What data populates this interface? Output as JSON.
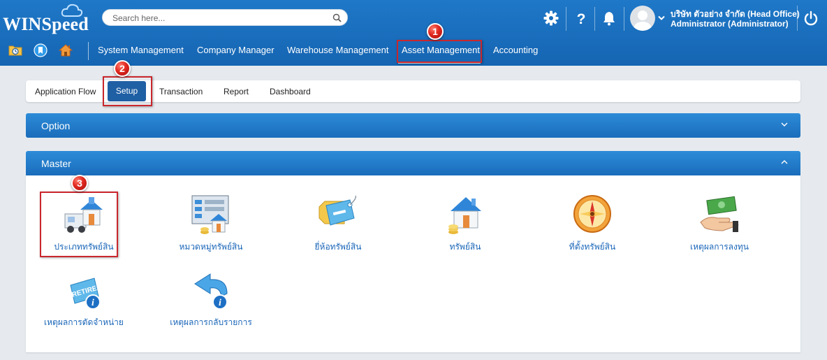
{
  "app": {
    "logo_text": "WINSpeed"
  },
  "search": {
    "placeholder": "Search here..."
  },
  "header": {
    "company": "บริษัท ตัวอย่าง จำกัด (Head Office)",
    "user": "Administrator (Administrator)"
  },
  "nav": {
    "items": [
      "System Management",
      "Company Manager",
      "Warehouse Management",
      "Asset Management",
      "Accounting"
    ],
    "active": "Asset Management"
  },
  "tabs": {
    "items": [
      "Application Flow",
      "Setup",
      "Transaction",
      "Report",
      "Dashboard"
    ],
    "active": "Setup"
  },
  "panels": {
    "option_title": "Option",
    "master_title": "Master"
  },
  "master_items": [
    "ประเภททรัพย์สิน",
    "หมวดหมู่ทรัพย์สิน",
    "ยี่ห้อทรัพย์สิน",
    "ทรัพย์สิน",
    "ที่ตั้งทรัพย์สิน",
    "เหตุผลการลงทุน",
    "เหตุผลการตัดจำหน่าย",
    "เหตุผลการกลับรายการ"
  ],
  "badges": [
    "1",
    "2",
    "3"
  ],
  "icons": {
    "header": [
      "gear-icon",
      "help-icon",
      "bell-icon",
      "power-icon"
    ],
    "quick": [
      "calendar-folder-icon",
      "bookmark-icon",
      "home-icon"
    ]
  },
  "colors": {
    "header_blue": "#1a6dbb",
    "highlight_red": "#c9272d",
    "link_blue": "#1a66b8",
    "active_tab": "#1f5fa4"
  }
}
